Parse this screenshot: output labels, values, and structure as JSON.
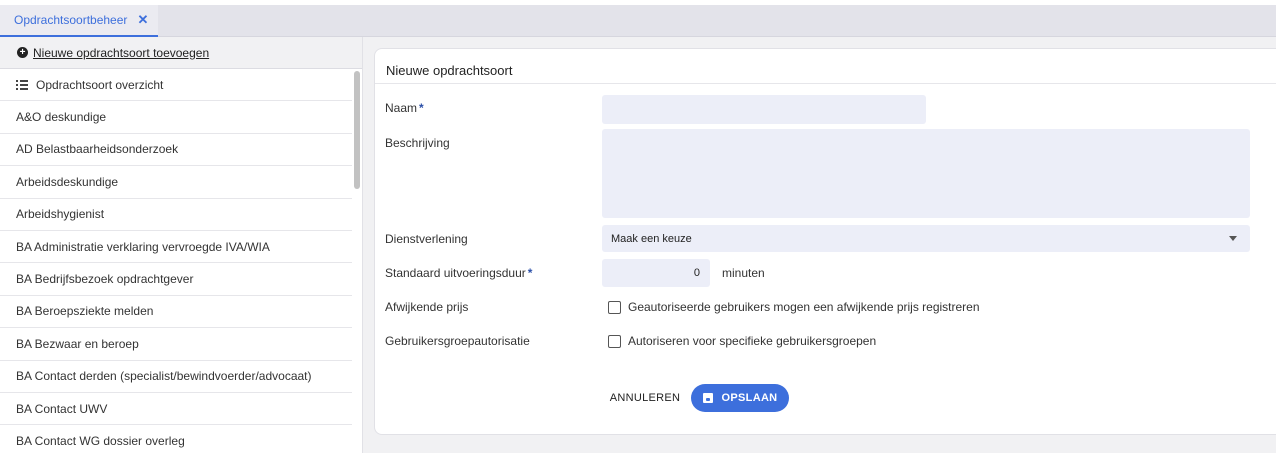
{
  "colors": {
    "accent": "#3d6fdc",
    "required_star": "#2b4fa8",
    "input_bg": "#eceef8"
  },
  "tabs": [
    {
      "label": "Opdrachtsoortbeheer",
      "active": true,
      "close_icon": "close-icon"
    }
  ],
  "sidebar": {
    "new_link": {
      "icon": "plus-circle-icon",
      "label": "Nieuwe opdrachtsoort toevoegen"
    },
    "overview": {
      "icon": "list-icon",
      "label": "Opdrachtsoort overzicht"
    },
    "items": [
      "A&O deskundige",
      "AD Belastbaarheidsonderzoek",
      "Arbeidsdeskundige",
      "Arbeidshygienist",
      "BA Administratie verklaring vervroegde IVA/WIA",
      "BA Bedrijfsbezoek opdrachtgever",
      "BA Beroepsziekte melden",
      "BA Bezwaar en beroep",
      "BA Contact derden (specialist/bewindvoerder/advocaat)",
      "BA Contact UWV",
      "BA Contact WG dossier overleg"
    ]
  },
  "form": {
    "title": "Nieuwe opdrachtsoort",
    "required_mark": "*",
    "naam": {
      "label": "Naam",
      "value": ""
    },
    "beschrijving": {
      "label": "Beschrijving",
      "value": ""
    },
    "dienstverlening": {
      "label": "Dienstverlening",
      "selected": "Maak een keuze",
      "icon": "chevron-down-icon"
    },
    "duur": {
      "label": "Standaard uitvoeringsduur",
      "value": "0",
      "unit": "minuten"
    },
    "afwijkende_prijs": {
      "label": "Afwijkende prijs",
      "checkbox_label": "Geautoriseerde gebruikers mogen een afwijkende prijs registreren",
      "checked": false
    },
    "groepautorisatie": {
      "label": "Gebruikersgroepautorisatie",
      "checkbox_label": "Autoriseren voor specifieke gebruikersgroepen",
      "checked": false
    },
    "cancel_label": "ANNULEREN",
    "save_label": "OPSLAAN",
    "save_icon": "save-icon"
  }
}
